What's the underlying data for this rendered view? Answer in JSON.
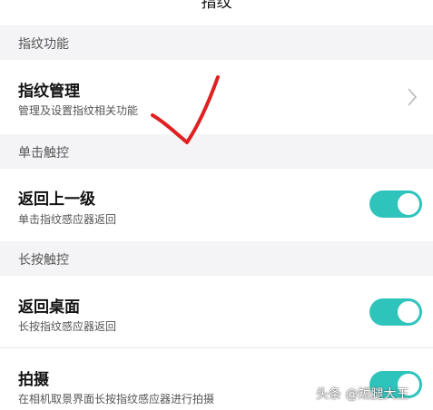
{
  "header": {
    "title": "指纹"
  },
  "sections": [
    {
      "label": "指纹功能",
      "items": [
        {
          "title": "指纹管理",
          "subtitle": "管理及设置指纹相关功能",
          "control": "chevron-right-icon"
        }
      ]
    },
    {
      "label": "单击触控",
      "items": [
        {
          "title": "返回上一级",
          "subtitle": "单击指纹感应器返回",
          "toggle_on": true
        }
      ]
    },
    {
      "label": "长按触控",
      "items": [
        {
          "title": "返回桌面",
          "subtitle": "长按指纹感应器返回",
          "toggle_on": true
        },
        {
          "title": "拍摄",
          "subtitle": "在相机取景界面长按指纹感应器进行拍摄",
          "toggle_on": true
        }
      ]
    }
  ],
  "annotation": {
    "icon": "red-checkmark-icon",
    "color": "#e02020"
  },
  "watermark": "头条 @短腿大王",
  "colors": {
    "accent": "#2ec4bc",
    "background": "#f4f4f6"
  }
}
